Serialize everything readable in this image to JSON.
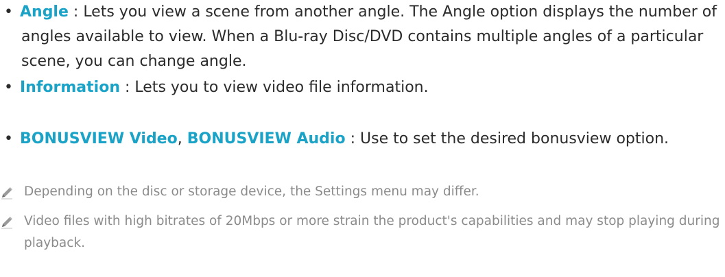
{
  "bullets": [
    {
      "term": "Angle",
      "separator": " : ",
      "description": "Lets you view a scene from another angle. The Angle option displays the number of angles available to view. When a Blu-ray Disc/DVD contains multiple angles of a particular scene, you can change angle."
    },
    {
      "term": "Information",
      "separator": " : ",
      "description": "Lets you to view video file information."
    },
    {
      "term": "BONUSVIEW Video",
      "term_joiner": ", ",
      "term2": "BONUSVIEW Audio",
      "separator": " : ",
      "description": "Use to set the desired bonusview option."
    }
  ],
  "notes": [
    {
      "icon": "pencil-note-icon",
      "text": "Depending on the disc or storage device, the Settings menu may differ."
    },
    {
      "icon": "pencil-note-icon",
      "text": "Video files with high bitrates of 20Mbps or more strain the product's capabilities and may stop playing during playback."
    }
  ],
  "colors": {
    "term": "#1aa3c7",
    "body_text": "#2b2b2b",
    "note_text": "#8b8b8b"
  }
}
